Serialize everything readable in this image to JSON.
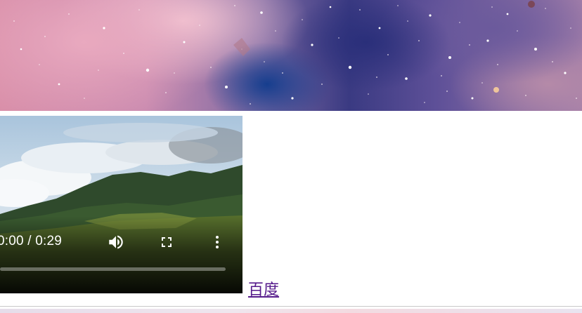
{
  "banner": {
    "image": "nebula-starfield"
  },
  "video": {
    "scene": "mountain-landscape",
    "time_display": "0:00 / 0:29",
    "progress": 0.0,
    "icons": {
      "volume": "volume-icon",
      "fullscreen": "fullscreen-icon",
      "more": "more-vert-icon"
    }
  },
  "link": {
    "label": "百度",
    "color": "#551a8b"
  }
}
